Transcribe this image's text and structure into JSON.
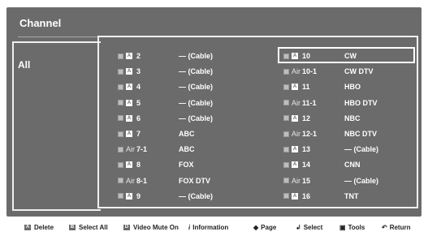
{
  "title": "Channel",
  "sidebar": {
    "selected_label": "All"
  },
  "left_column": [
    {
      "prefix": "",
      "number": "2",
      "name": "— (Cable)"
    },
    {
      "prefix": "",
      "number": "3",
      "name": "— (Cable)"
    },
    {
      "prefix": "",
      "number": "4",
      "name": "— (Cable)"
    },
    {
      "prefix": "",
      "number": "5",
      "name": "— (Cable)"
    },
    {
      "prefix": "",
      "number": "6",
      "name": "— (Cable)"
    },
    {
      "prefix": "",
      "number": "7",
      "name": "ABC"
    },
    {
      "prefix": "Air",
      "number": "7-1",
      "name": "ABC"
    },
    {
      "prefix": "",
      "number": "8",
      "name": "FOX"
    },
    {
      "prefix": "Air",
      "number": "8-1",
      "name": "FOX DTV"
    },
    {
      "prefix": "",
      "number": "9",
      "name": "— (Cable)"
    }
  ],
  "right_column": [
    {
      "prefix": "",
      "number": "10",
      "name": "CW"
    },
    {
      "prefix": "Air",
      "number": "10-1",
      "name": "CW DTV"
    },
    {
      "prefix": "",
      "number": "11",
      "name": "HBO"
    },
    {
      "prefix": "Air",
      "number": "11-1",
      "name": "HBO DTV"
    },
    {
      "prefix": "",
      "number": "12",
      "name": "NBC"
    },
    {
      "prefix": "Air",
      "number": "12-1",
      "name": "NBC DTV"
    },
    {
      "prefix": "",
      "number": "13",
      "name": "— (Cable)"
    },
    {
      "prefix": "",
      "number": "14",
      "name": "CNN"
    },
    {
      "prefix": "Air",
      "number": "15",
      "name": "— (Cable)"
    },
    {
      "prefix": "",
      "number": "16",
      "name": "TNT"
    }
  ],
  "footer": {
    "delete_key": "A",
    "delete": "Delete",
    "select_all_key": "B",
    "select_all": "Select All",
    "video_mute_key": "D",
    "video_mute": "Video Mute On",
    "info_icon": "i",
    "information": "Information",
    "page": "Page",
    "select": "Select",
    "tools": "Tools",
    "return": "Return"
  }
}
